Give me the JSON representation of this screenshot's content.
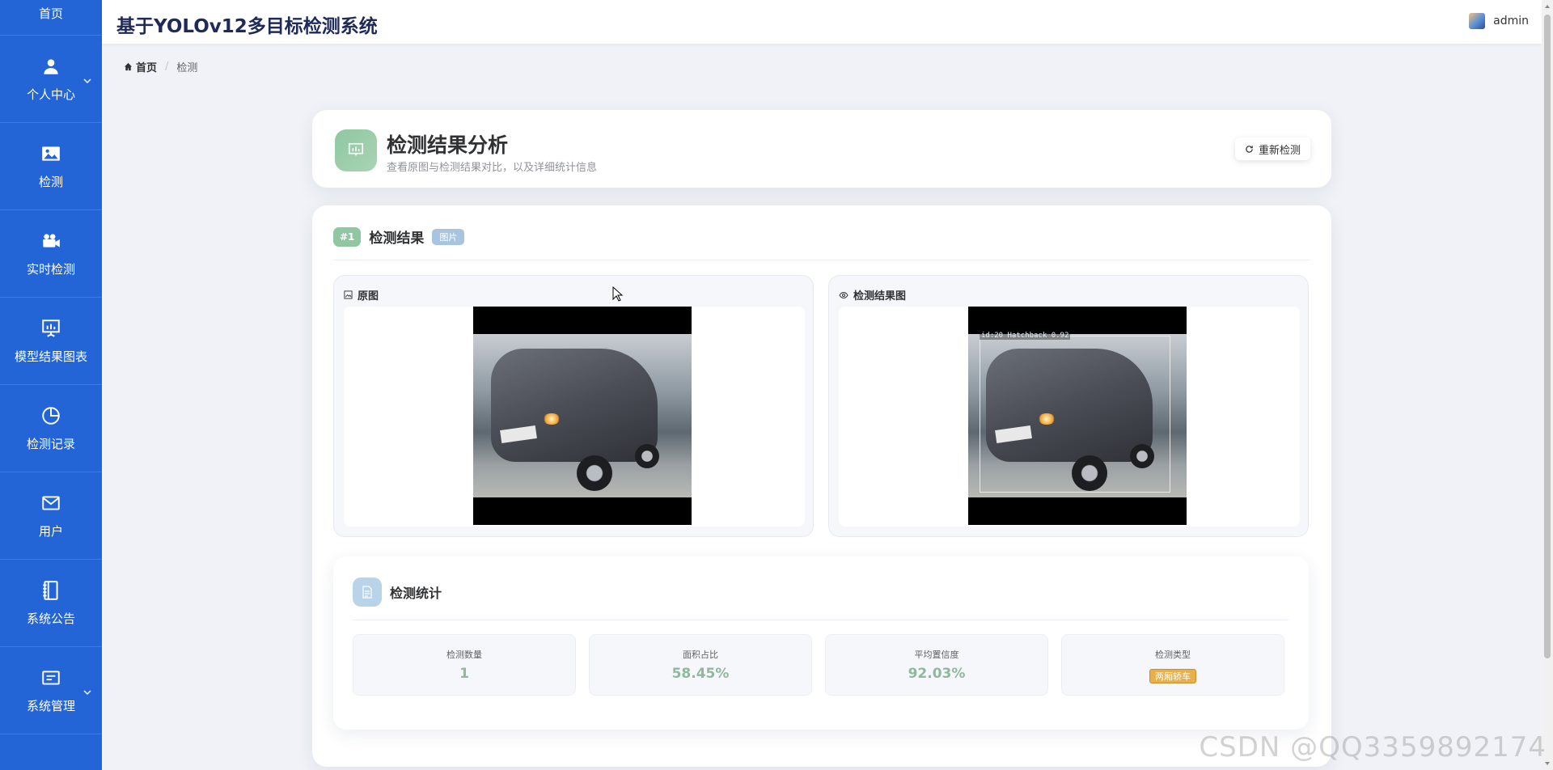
{
  "sidebar": {
    "items": [
      {
        "label": "首页",
        "icon": "home-icon"
      },
      {
        "label": "个人中心",
        "icon": "user-icon"
      },
      {
        "label": "检测",
        "icon": "image-icon"
      },
      {
        "label": "实时检测",
        "icon": "video-camera-icon"
      },
      {
        "label": "模型结果图表",
        "icon": "presentation-chart-icon"
      },
      {
        "label": "检测记录",
        "icon": "pie-chart-icon"
      },
      {
        "label": "用户",
        "icon": "mail-icon"
      },
      {
        "label": "系统公告",
        "icon": "notebook-icon"
      },
      {
        "label": "系统管理",
        "icon": "settings-card-icon"
      }
    ]
  },
  "header": {
    "title": "基于YOLOv12多目标检测系统",
    "username": "admin"
  },
  "breadcrumb": {
    "home": "首页",
    "current": "检测"
  },
  "result_header": {
    "title": "检测结果分析",
    "subtitle": "查看原图与检测结果对比，以及详细统计信息",
    "redo_label": "重新检测"
  },
  "result": {
    "index_badge": "#1",
    "title": "检测结果",
    "type_tag": "图片",
    "original_label": "原图",
    "detected_label": "检测结果图",
    "bbox_label": "id:20 Hatchback 0.92"
  },
  "stats": {
    "title": "检测统计",
    "items": [
      {
        "label": "检测数量",
        "value": "1"
      },
      {
        "label": "面积占比",
        "value": "58.45%"
      },
      {
        "label": "平均置信度",
        "value": "92.03%"
      },
      {
        "label": "检测类型",
        "value": "两厢轿车"
      }
    ]
  },
  "watermark": "CSDN @QQ3359892174",
  "colors": {
    "sidebar": "#2364d6",
    "accent_green": "#8fc7a2",
    "tag_orange": "#e8b04a"
  }
}
